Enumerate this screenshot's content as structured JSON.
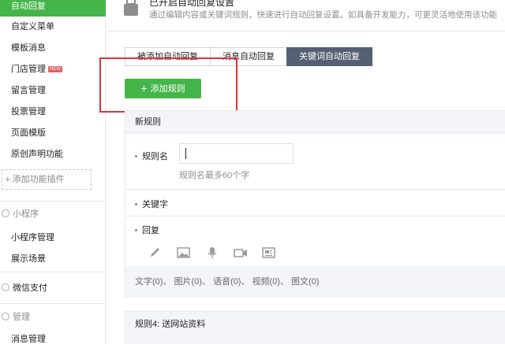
{
  "sidebar": {
    "items": [
      {
        "label": "自动回复",
        "active": true
      },
      {
        "label": "自定义菜单"
      },
      {
        "label": "模板消息"
      },
      {
        "label": "门店管理",
        "badge": "NEW"
      },
      {
        "label": "留言管理"
      },
      {
        "label": "投票管理"
      },
      {
        "label": "页面模版"
      },
      {
        "label": "原创声明功能"
      }
    ],
    "add_plugin": "添加功能插件",
    "groups": {
      "miniprogram": {
        "title": "小程序",
        "items": [
          "小程序管理",
          "展示场景"
        ]
      },
      "pay": {
        "title": "微信支付"
      },
      "manage": {
        "title": "管理",
        "items": [
          "消息管理"
        ]
      }
    }
  },
  "banner": {
    "title": "已开启自动回复设置",
    "desc": "通过编辑内容或关键词规则，快速进行自动回复设置。如具备开发能力，可更灵活地使用该功能"
  },
  "tabs": [
    "被添加自动回复",
    "消息自动回复",
    "关键词自动回复"
  ],
  "active_tab": 2,
  "add_rule_label": "添加规则",
  "panel": {
    "title": "新规则",
    "rule_name_label": "规则名",
    "rule_name_value": "",
    "rule_name_hint": "规则名最多60个字",
    "keyword_label": "关键字",
    "reply_label": "回复",
    "tools": [
      "pencil-icon",
      "image-icon",
      "microphone-icon",
      "video-icon",
      "news-icon"
    ],
    "counts": "文字(0)、 图片(0)、 语音(0)、 视频(0)、 图文(0)"
  },
  "existing_rule": "规则4: 送网站资料",
  "colors": {
    "accent": "#44b549",
    "tab_active": "#556072",
    "highlight": "#d9363e"
  }
}
